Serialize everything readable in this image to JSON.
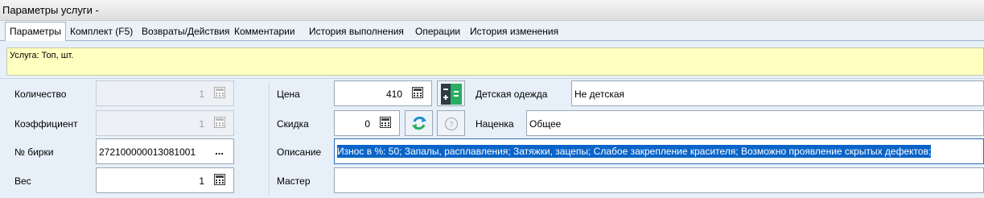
{
  "window": {
    "title": "Параметры услуги -"
  },
  "tabs": [
    {
      "label": "Параметры",
      "active": true
    },
    {
      "label": "Комплект (F5)"
    },
    {
      "label": "Возвраты/Действия"
    },
    {
      "label": "Комментарии"
    },
    {
      "label": "История выполнения"
    },
    {
      "label": "Операции"
    },
    {
      "label": "История изменения"
    }
  ],
  "service_line": "Услуга: Топ, шт.",
  "left": {
    "quantity": {
      "label": "Количество",
      "value": "1"
    },
    "coefficient": {
      "label": "Коэффициент",
      "value": "1"
    },
    "tag_number": {
      "label": "№ бирки",
      "value": "272100000013081001",
      "button": "..."
    },
    "weight": {
      "label": "Вес",
      "value": "1"
    }
  },
  "middle": {
    "price": {
      "label": "Цена",
      "value": "410"
    },
    "discount": {
      "label": "Скидка",
      "value": "0"
    },
    "description": {
      "label": "Описание",
      "value": "Износ в %: 50; Запалы, расплавления; Затяжки, зацепы; Слабое закрепление красителя; Возможно проявление скрытых дефектов;"
    },
    "master": {
      "label": "Мастер",
      "value": ""
    }
  },
  "right": {
    "children_clothes": {
      "label": "Детская одежда",
      "value": "Не детская"
    },
    "markup": {
      "label": "Наценка",
      "value": "Общее"
    }
  },
  "colors": {
    "accent": "#0a64c8",
    "service_bg": "#ffffc0",
    "calc_green": "#27ae60"
  },
  "icons": [
    "calculator-icon",
    "green-calculator-icon",
    "refresh-icon",
    "help-icon"
  ]
}
